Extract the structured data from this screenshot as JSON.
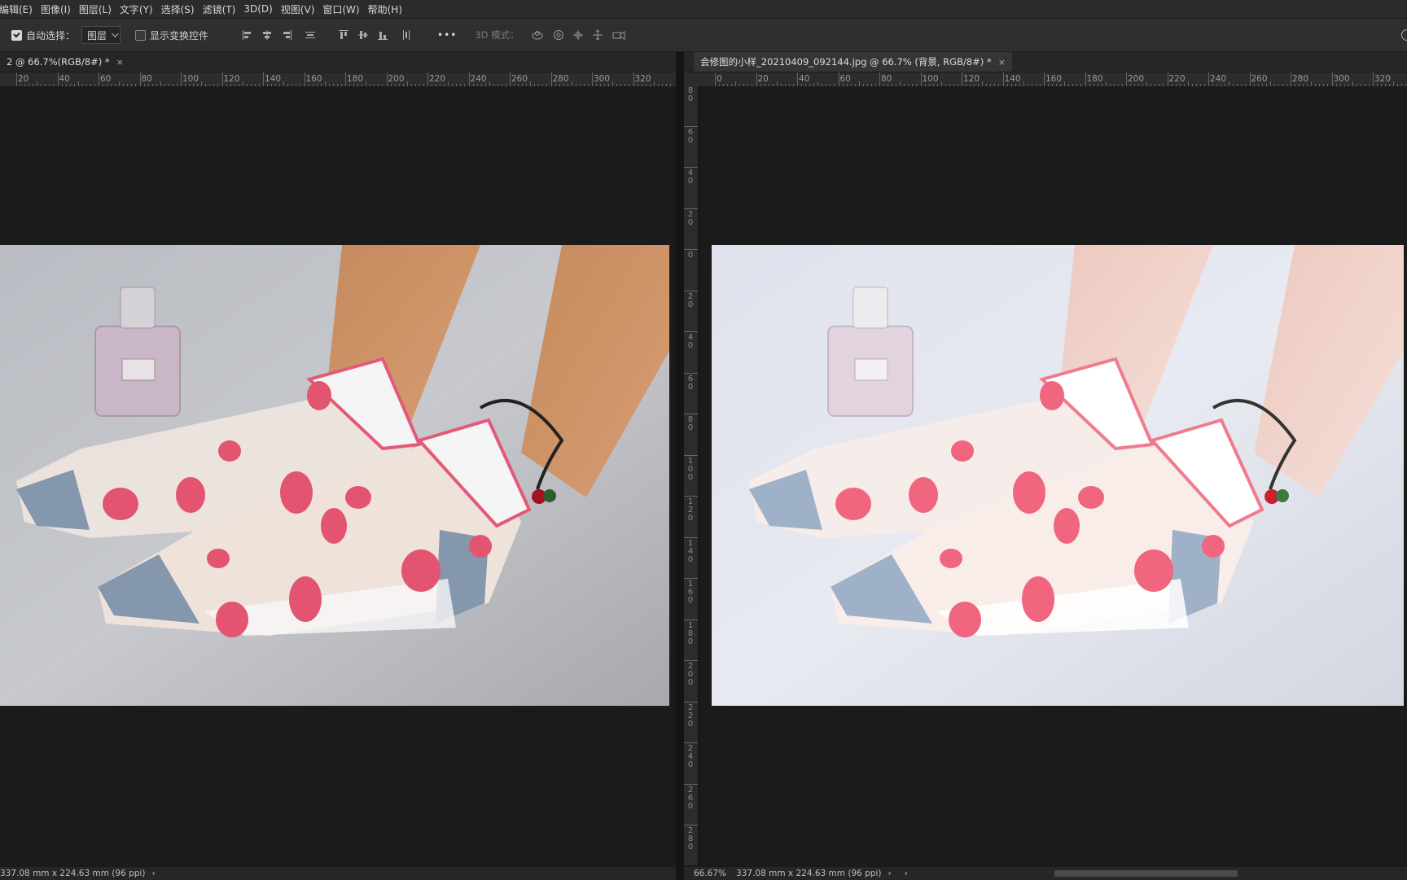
{
  "menu": {
    "items": [
      "编辑(E)",
      "图像(I)",
      "图层(L)",
      "文字(Y)",
      "选择(S)",
      "滤镜(T)",
      "3D(D)",
      "视图(V)",
      "窗口(W)",
      "帮助(H)"
    ]
  },
  "options": {
    "auto_select_label": "自动选择：",
    "auto_select_checked": true,
    "auto_select_target": "图层",
    "transform_label": "显示变换控件",
    "transform_checked": false,
    "more_label": "•••",
    "mode_3d_label": "3D 模式："
  },
  "left_doc": {
    "tab_title": "2 @ 66.7%(RGB/8#) *",
    "ruler_labels": [
      "20",
      "40",
      "60",
      "80",
      "100",
      "120",
      "140",
      "160",
      "180",
      "200",
      "220",
      "240",
      "260",
      "280",
      "300",
      "320"
    ],
    "status_dims": "337.08 mm x 224.63 mm (96 ppi)",
    "status_arrow": "›"
  },
  "right_doc": {
    "tab_title": "会修图的小样_20210409_092144.jpg @ 66.7% (背景, RGB/8#) *",
    "ruler_labels": [
      "0",
      "20",
      "40",
      "60",
      "80",
      "100",
      "120",
      "140",
      "160",
      "180",
      "200",
      "220",
      "240",
      "260",
      "280",
      "300",
      "320"
    ],
    "ruler_v_labels": [
      "80",
      "60",
      "40",
      "20",
      "0",
      "20",
      "40",
      "60",
      "80",
      "100",
      "120",
      "140",
      "160",
      "180",
      "200",
      "220",
      "240",
      "260",
      "280"
    ],
    "status_zoom": "66.67%",
    "status_dims": "337.08 mm x 224.63 mm (96 ppi)",
    "status_arrow": "›",
    "scroll_left": "‹"
  },
  "colors": {
    "app_bg": "#1b1b1b",
    "panel": "#2b2b2b",
    "left_background": "#c9cbd0",
    "right_background": "#e3e6ef",
    "sock_pink": "#e46a7c",
    "sock_toe": "#8b9db3",
    "skin_left": "#c7926b",
    "skin_right": "#efd6cf"
  },
  "icons": {
    "close": "close-icon"
  }
}
